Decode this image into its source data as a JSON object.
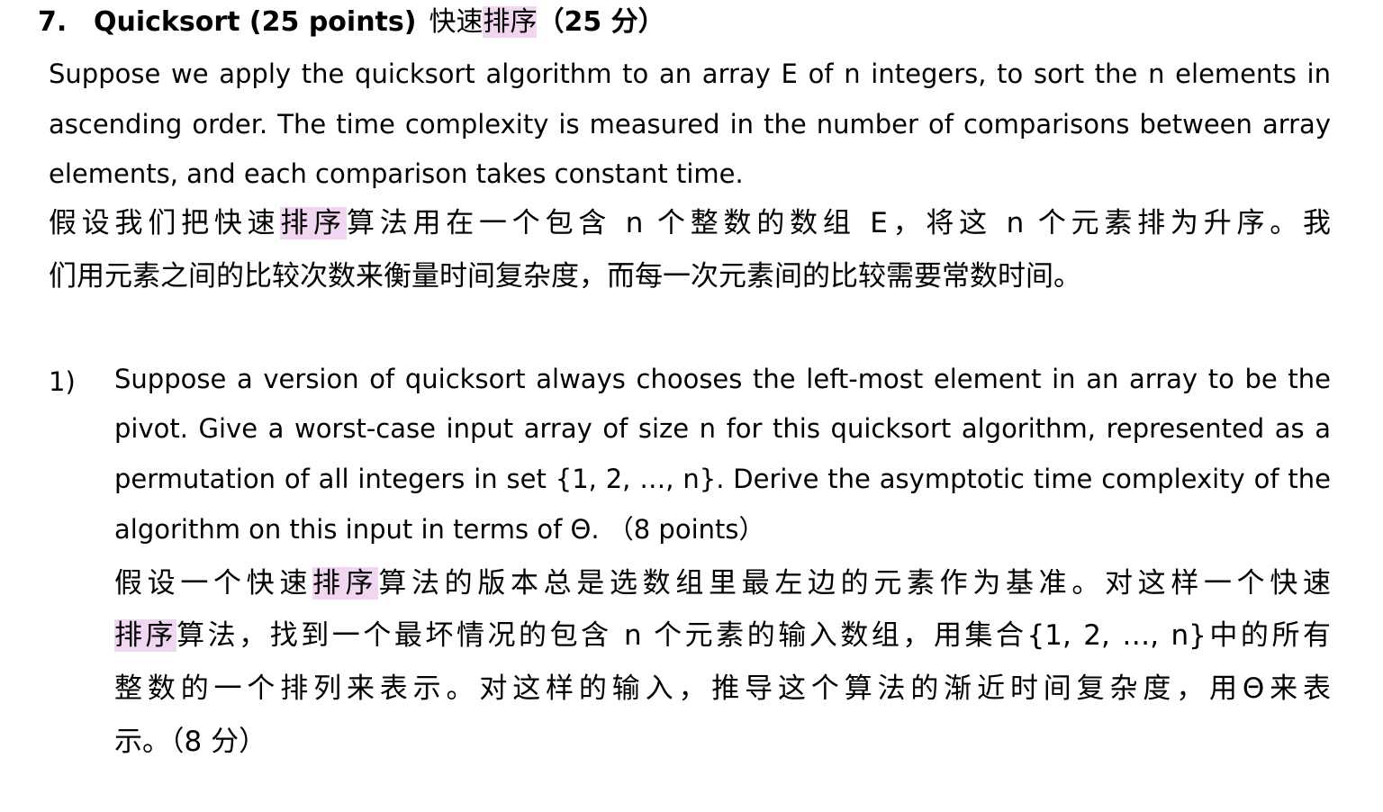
{
  "section": {
    "number": "7.",
    "title_en": "Quicksort (25 points)",
    "title_cn_prefix": "快速",
    "title_cn_highlight": "排序",
    "title_cn_points": "（25 分）"
  },
  "intro": {
    "en_lines": [
      "Suppose we apply the quicksort algorithm to an array E of n integers, to sort the n elements in",
      "ascending order. The time complexity is measured in the number of comparisons between array",
      "elements, and each comparison takes constant time."
    ],
    "cn_line1_a": "假设我们把快速",
    "cn_line1_hl": "排序",
    "cn_line1_b": "算法用在一个包含 n 个整数的数组 E，将这 n 个元素排为升序。我",
    "cn_line2": "们用元素之间的比较次数来衡量时间复杂度，而每一次元素间的比较需要常数时间。"
  },
  "question1": {
    "number": "1)",
    "en_lines": [
      "Suppose a version of quicksort always chooses the left-most element in an array to be the",
      "pivot. Give a worst-case input array of size n for this quicksort algorithm, represented as a",
      "permutation of all integers in set {1, 2, …, n}. Derive the asymptotic time complexity of the",
      "algorithm on this input in terms of Θ.  （8 points）"
    ],
    "cn_line1_a": "假设一个快速",
    "cn_line1_hl": "排序",
    "cn_line1_b": "算法的版本总是选数组里最左边的元素作为基准。对这样一个快速",
    "cn_line2_hl": "排序",
    "cn_line2_b": "算法，找到一个最坏情况的包含 n 个元素的输入数组，用集合{1, 2, …, n}中的所有",
    "cn_line3": "整数的一个排列来表示。对这样的输入，推导这个算法的渐近时间复杂度，用Θ来表",
    "cn_line4": "示。（8 分）"
  }
}
